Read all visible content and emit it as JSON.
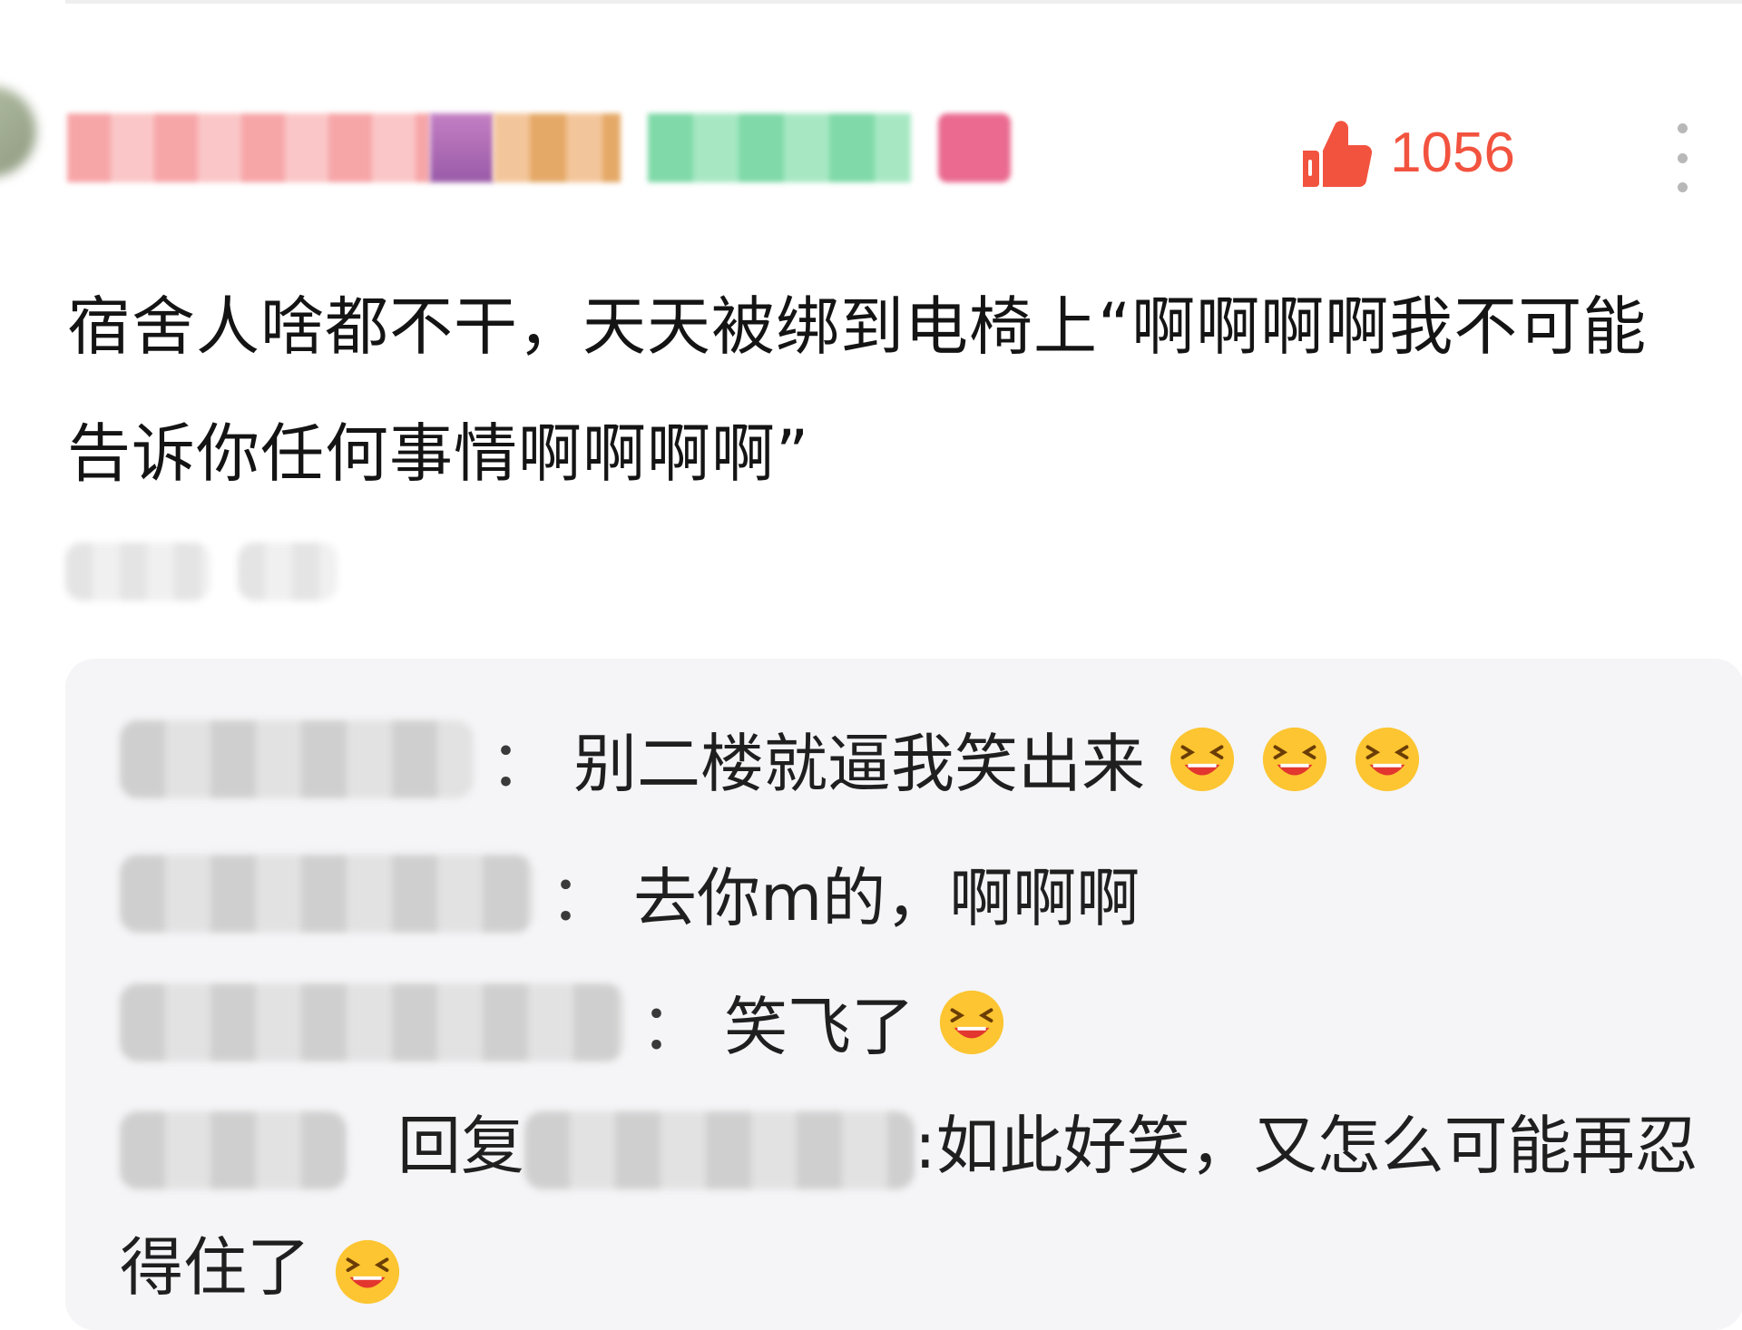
{
  "header": {
    "like_count": "1056",
    "colors": {
      "like_accent": "#f2533f",
      "more_dots": "#b8b8b8"
    },
    "icons": {
      "like": "thumb-up-icon",
      "more": "more-vertical-icon"
    }
  },
  "comment": {
    "body": "宿舍人啥都不干，天天被绑到电椅上“啊啊啊啊我不可能告诉你任何事情啊啊啊啊”"
  },
  "replies": [
    {
      "text": "别二楼就逼我笑出来",
      "emoji_count": 3
    },
    {
      "text": "去你m的，啊啊啊",
      "emoji_count": 0
    },
    {
      "text": "笑飞了",
      "emoji_count": 1
    },
    {
      "reply_label": "回复",
      "text": ":如此好笑，又怎么可能再忍得住了",
      "emoji_count": 1
    }
  ],
  "reply_separator": "：",
  "emoji": {
    "name": "laughing-emoji-icon",
    "colors": {
      "face": "#fcc531",
      "mouth": "#e2362f"
    }
  }
}
